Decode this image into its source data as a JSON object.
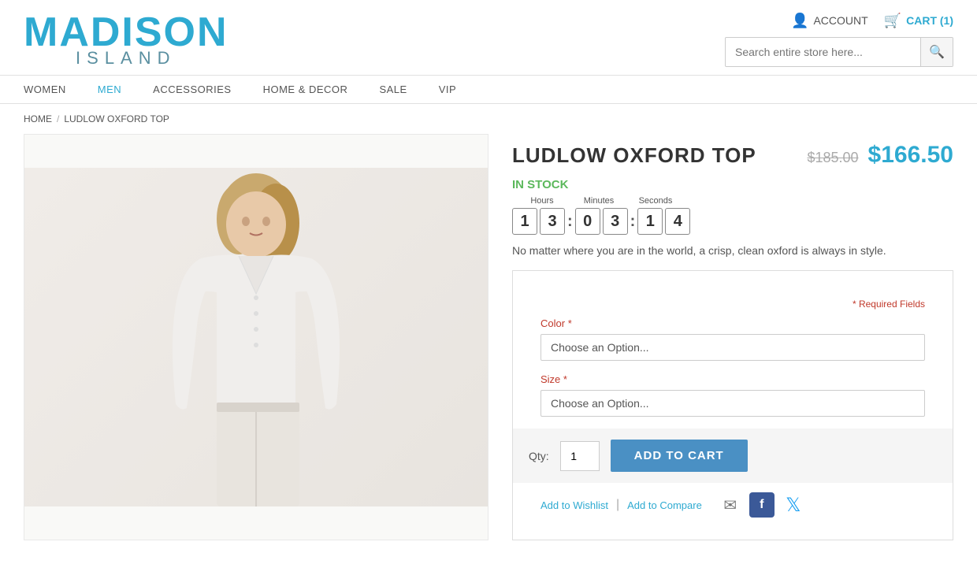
{
  "logo": {
    "madison": "MADISON",
    "island": "ISLAND"
  },
  "header": {
    "account_label": "ACCOUNT",
    "cart_label": "CART (1)",
    "search_placeholder": "Search entire store here..."
  },
  "nav": {
    "items": [
      {
        "label": "WOMEN",
        "id": "women"
      },
      {
        "label": "MEN",
        "id": "men"
      },
      {
        "label": "ACCESSORIES",
        "id": "accessories"
      },
      {
        "label": "HOME & DECOR",
        "id": "home-decor"
      },
      {
        "label": "SALE",
        "id": "sale"
      },
      {
        "label": "VIP",
        "id": "vip"
      }
    ]
  },
  "breadcrumb": {
    "home": "HOME",
    "separator": "/",
    "current": "LUDLOW OXFORD TOP"
  },
  "product": {
    "title": "LUDLOW OXFORD TOP",
    "price_original": "$185.00",
    "price_sale": "$166.50",
    "stock_status": "IN STOCK",
    "countdown": {
      "hours_label": "Hours",
      "minutes_label": "Minutes",
      "seconds_label": "Seconds",
      "digits": [
        "1",
        "3",
        "0",
        "3",
        "1",
        "4"
      ]
    },
    "description": "No matter where you are in the world, a crisp, clean oxford is always in style.",
    "required_fields_label": "* Required Fields",
    "color_label": "Color",
    "color_required": "*",
    "color_placeholder": "Choose an Option...",
    "size_label": "Size",
    "size_required": "*",
    "size_placeholder": "Choose an Option...",
    "qty_label": "Qty:",
    "qty_value": "1",
    "add_to_cart_label": "ADD TO CART",
    "wishlist_label": "Add to Wishlist",
    "separator": "|",
    "compare_label": "Add to Compare"
  }
}
